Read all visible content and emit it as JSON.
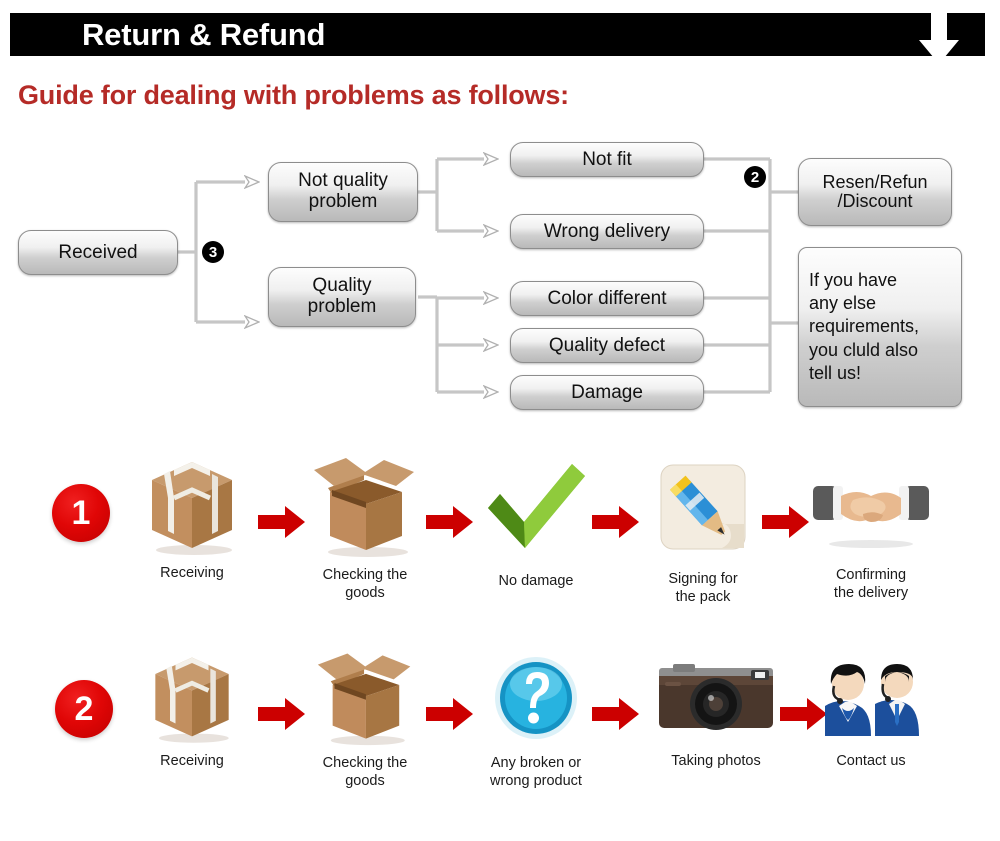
{
  "banner": {
    "title": "Return & Refund",
    "arrow_icon": "down-arrow-icon"
  },
  "guide_heading": "Guide for dealing with problems as follows:",
  "colors": {
    "banner_bg": "#000000",
    "heading_red": "#b52b27",
    "arrow_red": "#cc0000",
    "badge_red": "#e00606",
    "node_border": "#8d8d8d",
    "connector": "#c9c9c9"
  },
  "flowchart": {
    "nodes": {
      "received": "Received",
      "not_quality_problem": "Not quality\nproblem",
      "quality_problem": "Quality\nproblem",
      "not_fit": "Not fit",
      "wrong_delivery": "Wrong delivery",
      "color_different": "Color different",
      "quality_defect": "Quality defect",
      "damage": "Damage",
      "resend_refund_discount": "Resen/Refun\n/Discount",
      "memo": "If you have\nany else\nrequirements,\nyou cluld also\ntell us!"
    },
    "markers": {
      "branch_three": "3",
      "branch_two": "2"
    }
  },
  "process_rows": [
    {
      "number": "1",
      "steps": [
        {
          "icon": "sealed-box-icon",
          "label": "Receiving"
        },
        {
          "icon": "open-box-icon",
          "label": "Checking the\ngoods"
        },
        {
          "icon": "green-check-icon",
          "label": "No damage"
        },
        {
          "icon": "pencil-signing-icon",
          "label": "Signing for\nthe pack"
        },
        {
          "icon": "handshake-icon",
          "label": "Confirming\nthe delivery"
        }
      ]
    },
    {
      "number": "2",
      "steps": [
        {
          "icon": "sealed-box-icon",
          "label": "Receiving"
        },
        {
          "icon": "open-box-icon",
          "label": "Checking the\ngoods"
        },
        {
          "icon": "question-mark-icon",
          "label": "Any broken or\nwrong product"
        },
        {
          "icon": "camera-icon",
          "label": "Taking photos"
        },
        {
          "icon": "support-agents-icon",
          "label": "Contact us"
        }
      ]
    }
  ]
}
